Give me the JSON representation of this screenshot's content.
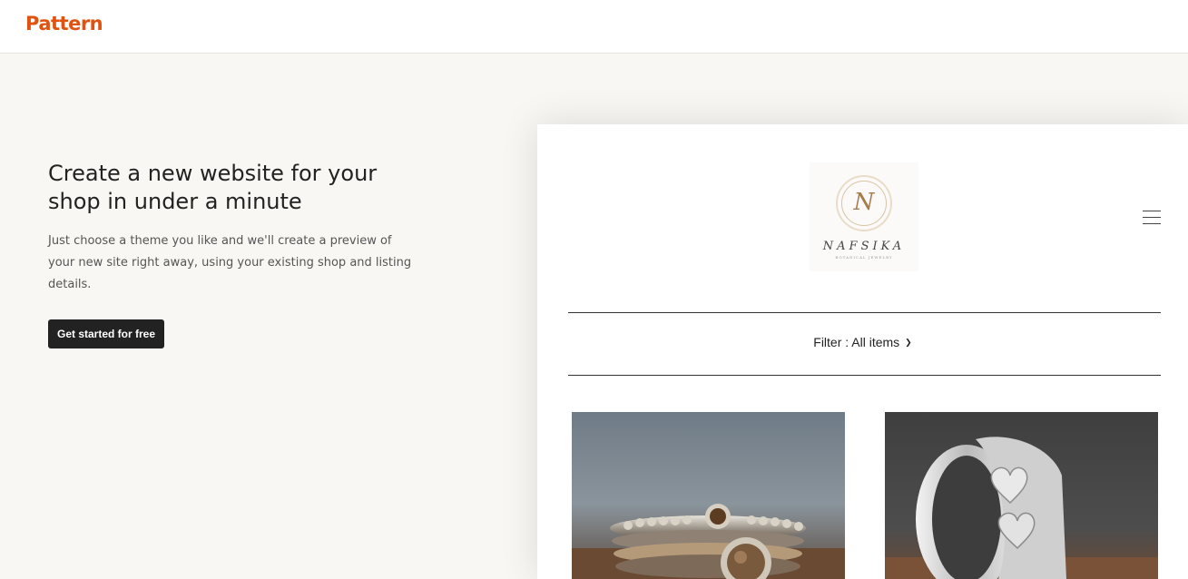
{
  "brand": {
    "logo_text": "Pattern",
    "accent": "#e0520f"
  },
  "hero": {
    "title": "Create a new website for your shop in under a minute",
    "description": "Just choose a theme you like and we'll create a preview of your new site right away, using your existing shop and listing details.",
    "cta_label": "Get started for free"
  },
  "preview": {
    "shop_logo_letter": "N",
    "shop_name": "NAFSIKA",
    "shop_tagline": "BOTANICAL JEWELRY",
    "menu_icon": "hamburger-icon",
    "filter_label": "Filter : All items",
    "filter_icon": "chevron-down-icon",
    "products": [
      {
        "image": "stacked-rings-photo"
      },
      {
        "image": "heart-band-ring-photo"
      }
    ]
  }
}
